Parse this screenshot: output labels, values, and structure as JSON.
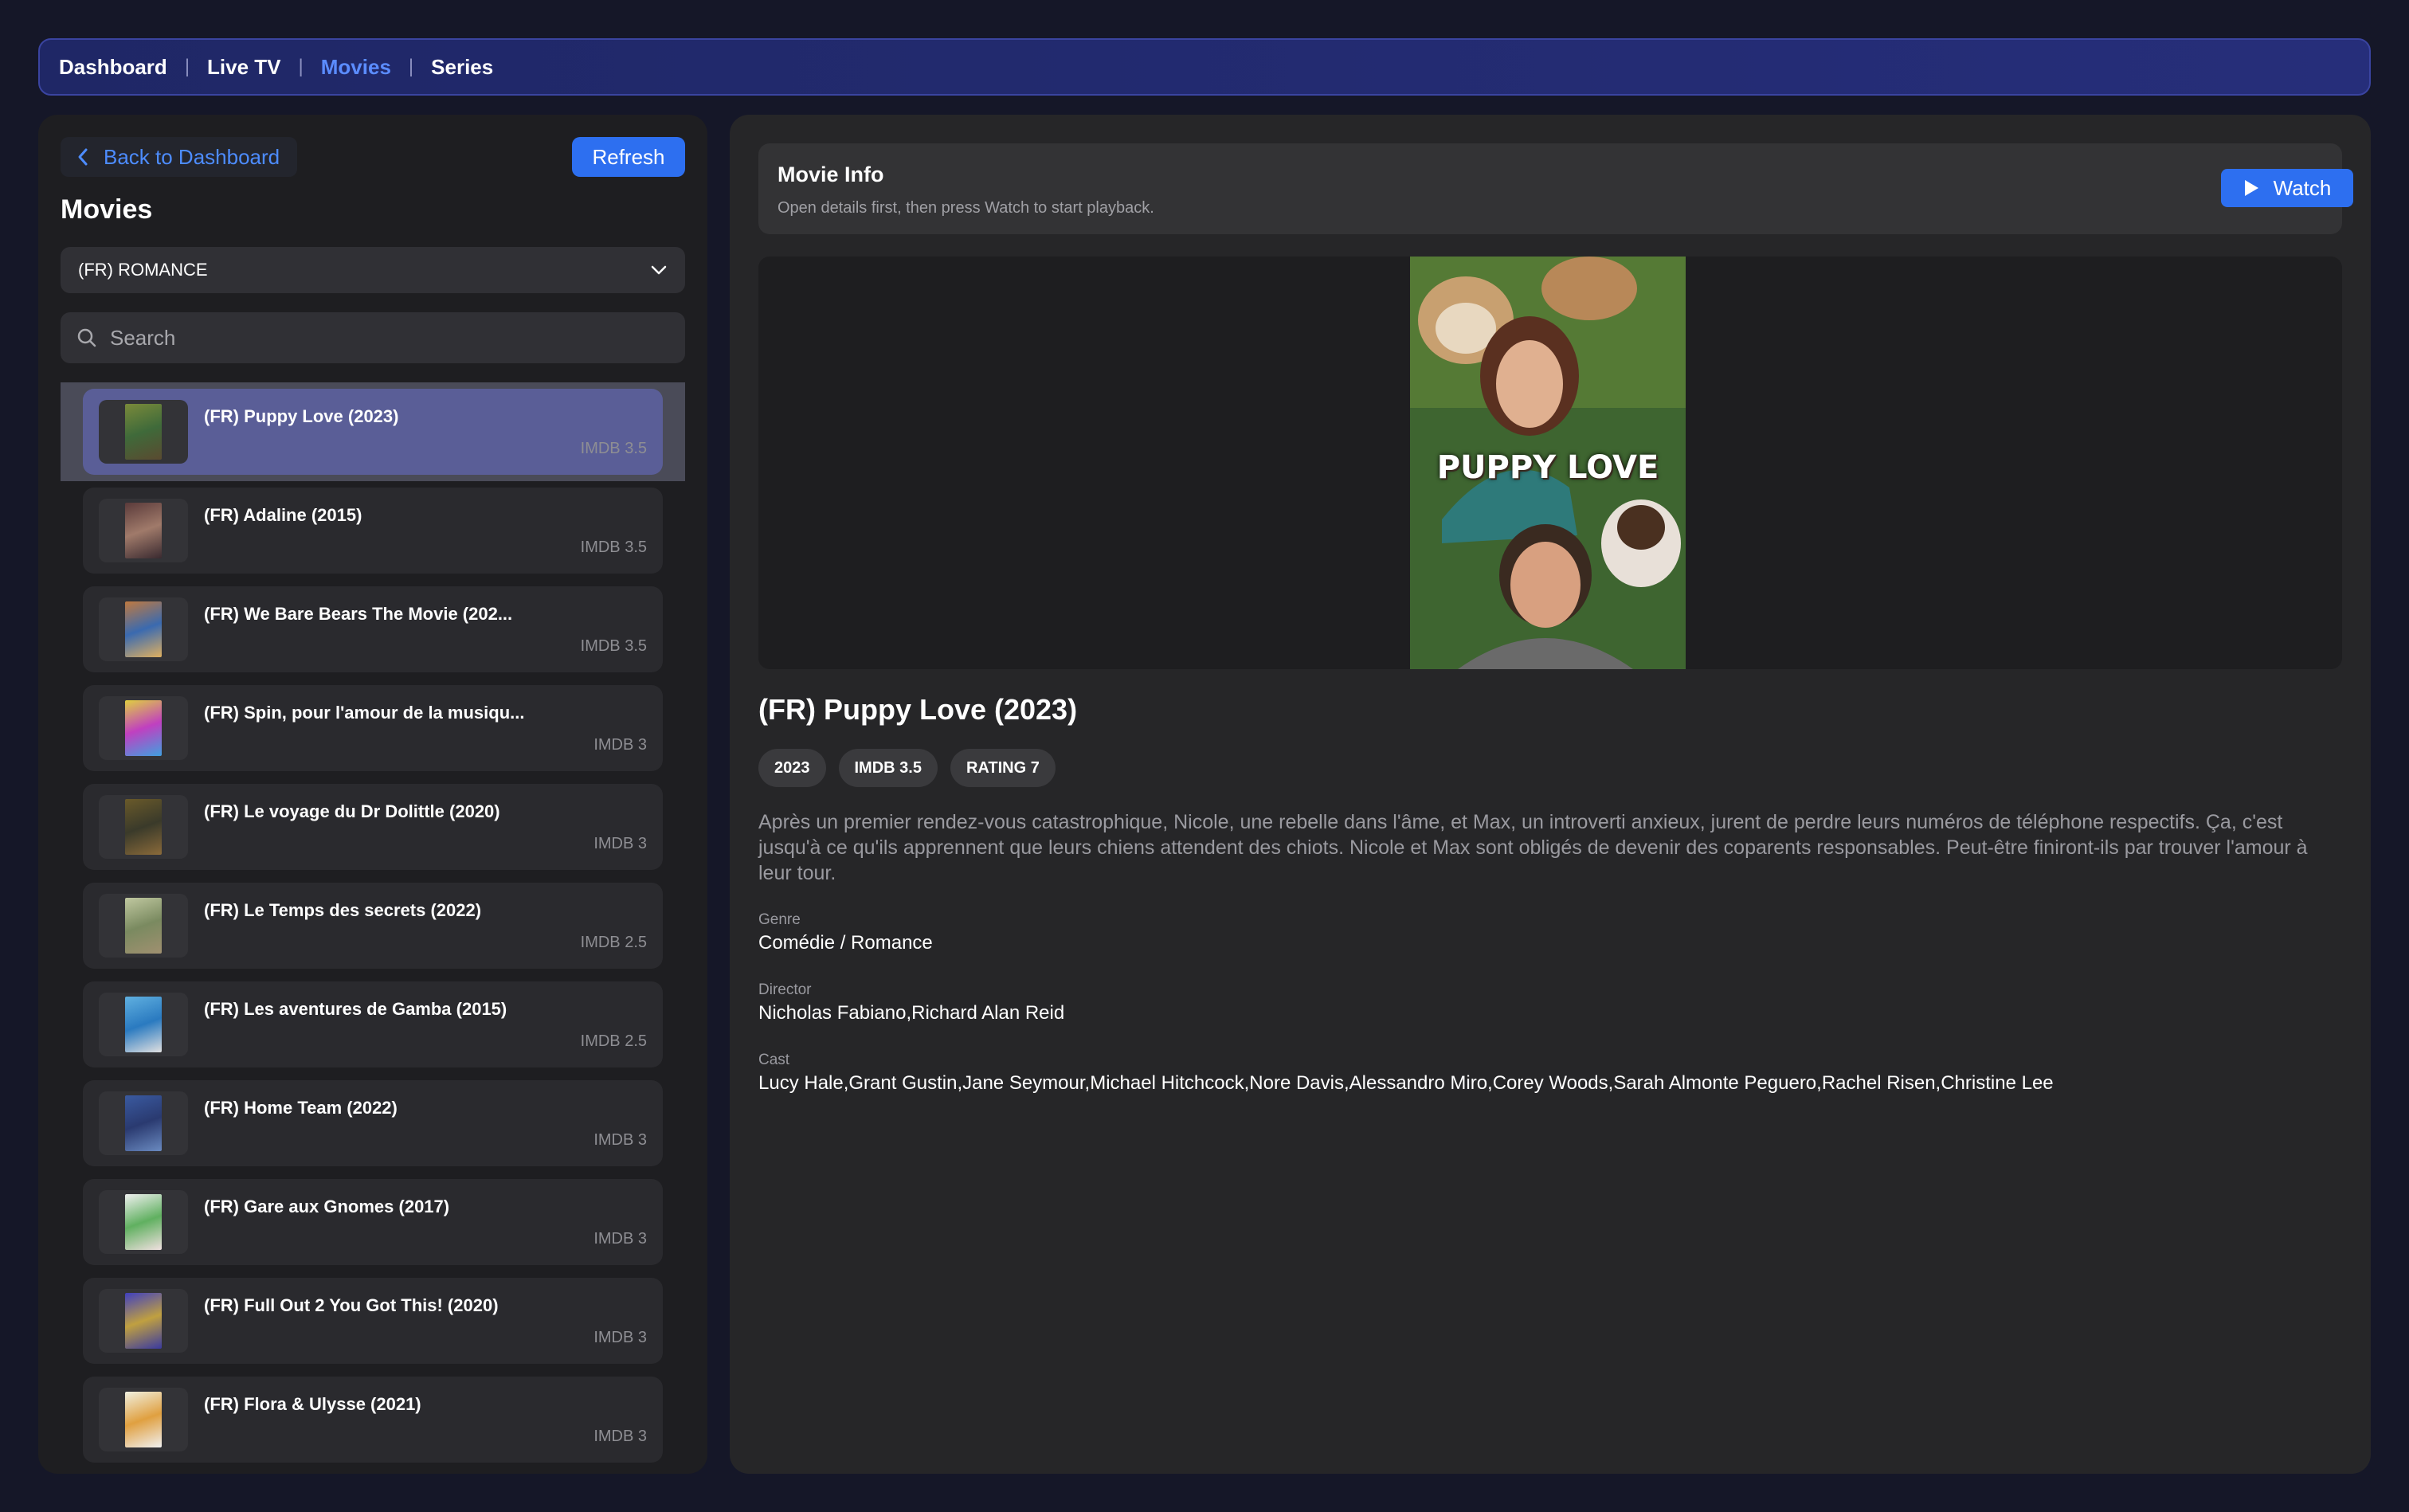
{
  "nav": {
    "items": [
      "Dashboard",
      "Live TV",
      "Movies",
      "Series"
    ],
    "separator": "|"
  },
  "sidebar": {
    "back_label": "Back to Dashboard",
    "refresh_label": "Refresh",
    "title": "Movies",
    "category": "(FR) ROMANCE",
    "search_placeholder": "Search",
    "movies": [
      {
        "title": "(FR) Puppy Love (2023)",
        "imdb": "IMDB 3.5"
      },
      {
        "title": "(FR) Adaline (2015)",
        "imdb": "IMDB 3.5"
      },
      {
        "title": "(FR) We Bare Bears The Movie (202...",
        "imdb": "IMDB 3.5"
      },
      {
        "title": "(FR) Spin, pour l'amour de la musiqu...",
        "imdb": "IMDB 3"
      },
      {
        "title": "(FR) Le voyage du Dr Dolittle (2020)",
        "imdb": "IMDB 3"
      },
      {
        "title": "(FR) Le Temps des secrets (2022)",
        "imdb": "IMDB 2.5"
      },
      {
        "title": "(FR) Les aventures de Gamba (2015)",
        "imdb": "IMDB 2.5"
      },
      {
        "title": "(FR) Home Team (2022)",
        "imdb": "IMDB 3"
      },
      {
        "title": "(FR) Gare aux Gnomes (2017)",
        "imdb": "IMDB 3"
      },
      {
        "title": "(FR) Full Out 2 You Got This! (2020)",
        "imdb": "IMDB 3"
      },
      {
        "title": "(FR) Flora & Ulysse (2021)",
        "imdb": "IMDB 3"
      }
    ]
  },
  "info": {
    "title": "Movie Info",
    "subtitle": "Open details first, then press Watch to start playback.",
    "watch_label": "Watch"
  },
  "detail": {
    "poster_text": "PUPPY LOVE",
    "title": "(FR) Puppy Love (2023)",
    "badges": [
      "2023",
      "IMDB 3.5",
      "RATING 7"
    ],
    "description": "Après un premier rendez-vous catastrophique, Nicole, une rebelle dans l'âme, et Max, un introverti anxieux, jurent de perdre leurs numéros de téléphone respectifs. Ça, c'est jusqu'à ce qu'ils apprennent que leurs chiens attendent des chiots. Nicole et Max sont obligés de devenir des coparents responsables. Peut-être finiront-ils par trouver l'amour à leur tour.",
    "genre_label": "Genre",
    "genre": "Comédie / Romance",
    "director_label": "Director",
    "director": "Nicholas Fabiano,Richard Alan Reid",
    "cast_label": "Cast",
    "cast": "Lucy Hale,Grant Gustin,Jane Seymour,Michael Hitchcock,Nore Davis,Alessandro Miro,Corey Woods,Sarah Almonte Peguero,Rachel Risen,Christine Lee"
  },
  "colors": {
    "accent": "#2d6ff0",
    "nav_active": "#5b8cff",
    "background": "#151728"
  }
}
